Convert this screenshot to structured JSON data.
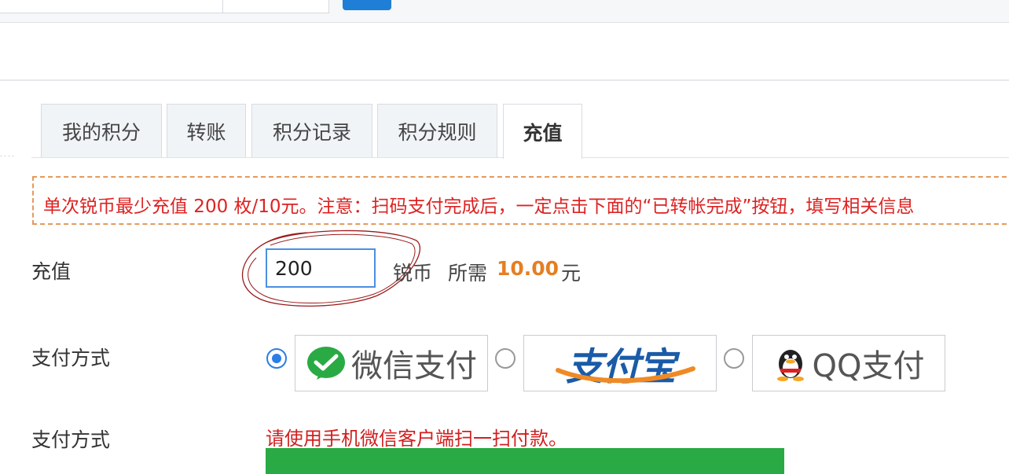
{
  "tabs": [
    {
      "label": "我的积分",
      "active": false
    },
    {
      "label": "转账",
      "active": false
    },
    {
      "label": "积分记录",
      "active": false
    },
    {
      "label": "积分规则",
      "active": false
    },
    {
      "label": "充值",
      "active": true
    }
  ],
  "notice": {
    "text": "单次锐币最少充值 200 枚/10元。注意：扫码支付完成后，一定点击下面的“已转帐完成”按钮，填写相关信息"
  },
  "recharge": {
    "label": "充值",
    "amount_value": "200",
    "unit": "锐币",
    "required_label": "所需",
    "price": "10.00",
    "currency": "元"
  },
  "payment": {
    "label": "支付方式",
    "options": [
      {
        "name": "微信支付",
        "selected": true,
        "icon": "wechat-icon"
      },
      {
        "name": "支付宝",
        "selected": false,
        "icon": "alipay-logo"
      },
      {
        "name": "QQ支付",
        "selected": false,
        "icon": "qq-penguin-icon"
      }
    ]
  },
  "instruction": {
    "label": "支付方式",
    "hint": "请使用手机微信客户端扫一扫付款。"
  },
  "colors": {
    "accent_blue": "#2b7de9",
    "notice_red": "#d22222",
    "price_orange": "#e67e22",
    "wechat_green": "#2aaa44"
  }
}
